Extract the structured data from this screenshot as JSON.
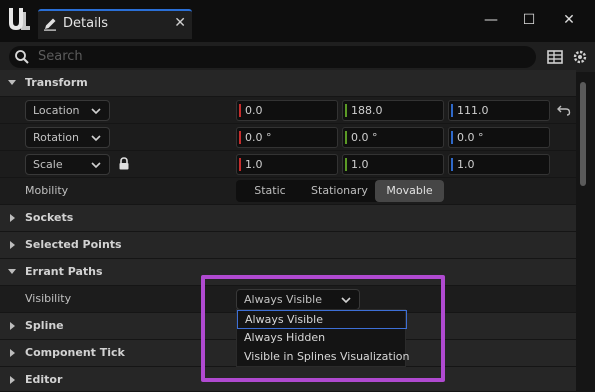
{
  "window": {
    "tab_title": "Details",
    "close_tab": "✕",
    "minimize": "—",
    "maximize": "☐",
    "close": "✕"
  },
  "search": {
    "placeholder": "Search"
  },
  "sections": {
    "transform": {
      "label": "Transform",
      "location": {
        "mode": "Location",
        "x": "0.0",
        "y": "188.0",
        "z": "111.0"
      },
      "rotation": {
        "mode": "Rotation",
        "x": "0.0 °",
        "y": "0.0 °",
        "z": "0.0 °"
      },
      "scale": {
        "mode": "Scale",
        "x": "1.0",
        "y": "1.0",
        "z": "1.0"
      },
      "mobility": {
        "label": "Mobility",
        "options": [
          "Static",
          "Stationary",
          "Movable"
        ],
        "selected": "Movable"
      }
    },
    "sockets": {
      "label": "Sockets"
    },
    "selected_points": {
      "label": "Selected Points"
    },
    "errant_paths": {
      "label": "Errant Paths",
      "visibility": {
        "label": "Visibility",
        "value": "Always Visible",
        "options": [
          "Always Visible",
          "Always Hidden",
          "Visible in Splines Visualization"
        ]
      }
    },
    "spline": {
      "label": "Spline"
    },
    "component_tick": {
      "label": "Component Tick"
    },
    "editor": {
      "label": "Editor"
    }
  },
  "colors": {
    "x_axis": "#c62d2d",
    "y_axis": "#5b9a25",
    "z_axis": "#2f69c9",
    "accent": "#2a6fd6",
    "highlight": "#b04ad1"
  }
}
